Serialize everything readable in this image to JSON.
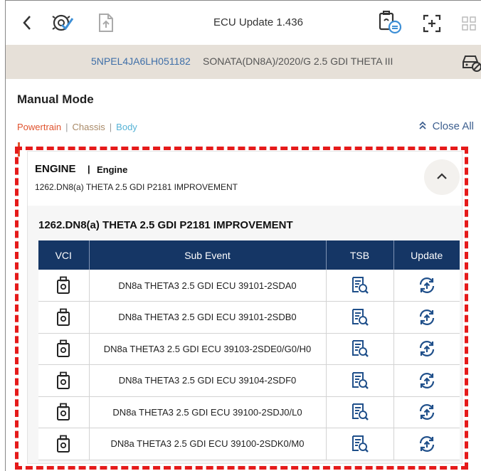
{
  "header": {
    "title": "ECU Update 1.436",
    "icons": [
      "back-chevron-icon",
      "ecu-check-icon",
      "file-upload-icon",
      "vci-status-icon",
      "screen-capture-icon",
      "grid-menu-icon"
    ]
  },
  "vehicle": {
    "vin": "5NPEL4JA6LH051182",
    "model": "SONATA(DN8A)/2020/G 2.5 GDI THETA III"
  },
  "page": {
    "mode_title": "Manual Mode",
    "systems": [
      "Powertrain",
      "Chassis",
      "Body"
    ],
    "close_all": "Close All"
  },
  "engine": {
    "title": "ENGINE",
    "subtitle": "Engine",
    "description": "1262.DN8(a) THETA 2.5 GDI P2181 IMPROVEMENT",
    "section_title": "1262.DN8(a) THETA 2.5 GDI P2181 IMPROVEMENT"
  },
  "table": {
    "headers": [
      "VCI",
      "Sub Event",
      "TSB",
      "Update"
    ],
    "rows": [
      {
        "sub_event": "DN8a THETA3 2.5 GDI ECU 39101-2SDA0"
      },
      {
        "sub_event": "DN8a THETA3 2.5 GDI ECU 39101-2SDB0"
      },
      {
        "sub_event": "DN8a THETA3 2.5 GDI ECU 39103-2SDE0/G0/H0"
      },
      {
        "sub_event": "DN8a THETA3 2.5 GDI ECU 39104-2SDF0"
      },
      {
        "sub_event": "DN8a THETA3 2.5 GDI ECU 39100-2SDJ0/L0"
      },
      {
        "sub_event": "DN8a THETA3 2.5 GDI ECU 39100-2SDK0/M0"
      }
    ]
  },
  "colors": {
    "powertrain": "#e0532e",
    "chassis": "#a98a68",
    "body": "#56b3d6",
    "table_header": "#153665",
    "highlight": "#e51a1a",
    "icon_blue": "#1f4f8a"
  }
}
